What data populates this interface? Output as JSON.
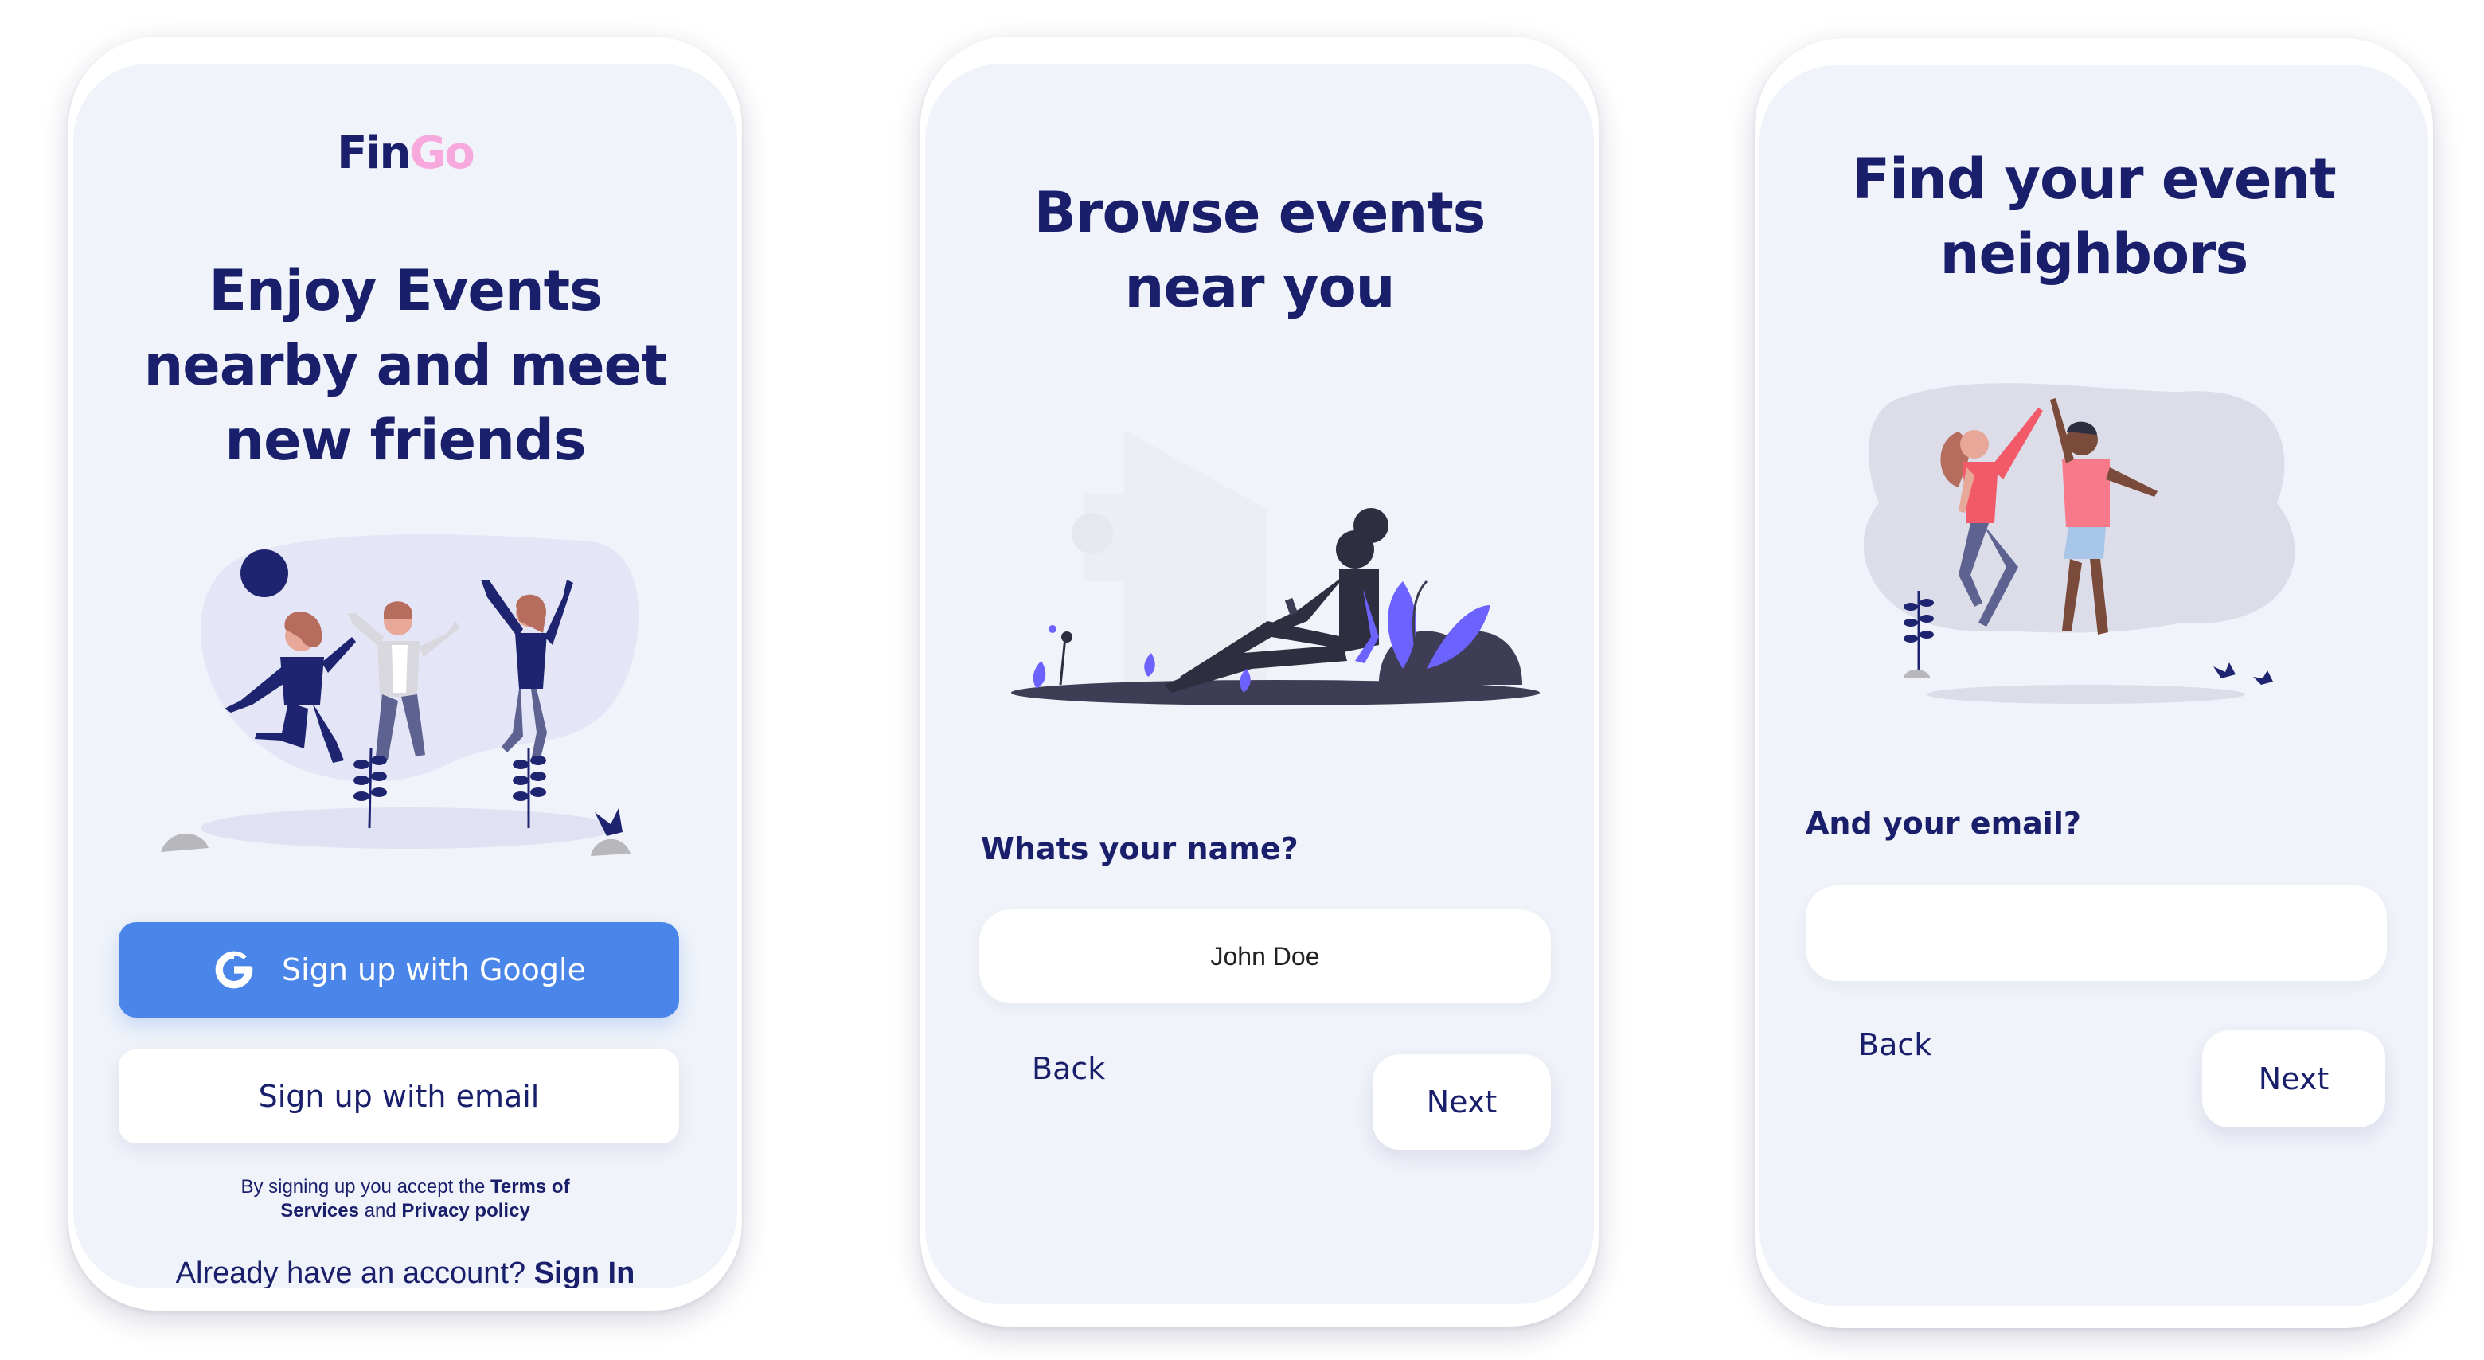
{
  "colors": {
    "navy": "#1a1f6b",
    "accent_pink": "#f7a8dc",
    "google_blue": "#4a86ea",
    "screen_bg": "#f0f3f9",
    "illustration_purple": "#6c63ff"
  },
  "screen1": {
    "logo_part1": "Fin",
    "logo_part2": "Go",
    "headline": [
      "Enjoy Events",
      "nearby and meet",
      "new friends"
    ],
    "illustration": "friends-jumping-illustration",
    "google_button": {
      "icon": "google-g-icon",
      "label": "Sign up with Google"
    },
    "email_button": {
      "label": "Sign up with email"
    },
    "terms": {
      "prefix": "By signing up you accept the ",
      "terms_link": "Terms of Services",
      "conjunction": " and ",
      "privacy_link": "Privacy policy"
    },
    "signin": {
      "prompt": "Already have an account? ",
      "link": "Sign In"
    }
  },
  "screen2": {
    "headline": [
      "Browse events",
      "near you"
    ],
    "illustration": "woman-sitting-phone-illustration",
    "field_label": "Whats your name?",
    "name_input_value": "John Doe",
    "back_label": "Back",
    "next_label": "Next"
  },
  "screen3": {
    "headline": [
      "Find your event",
      "neighbors"
    ],
    "illustration": "high-five-illustration",
    "field_label": "And your email?",
    "email_input_value": "",
    "back_label": "Back",
    "next_label": "Next"
  }
}
